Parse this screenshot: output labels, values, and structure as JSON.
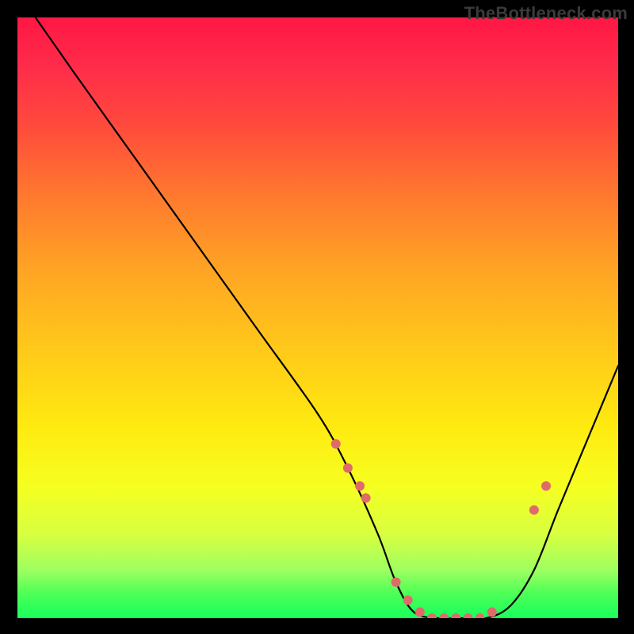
{
  "watermark": "TheBottleneck.com",
  "chart_data": {
    "type": "line",
    "title": "",
    "xlabel": "",
    "ylabel": "",
    "xlim": [
      0,
      100
    ],
    "ylim": [
      0,
      100
    ],
    "grid": false,
    "legend": false,
    "series": [
      {
        "name": "curve",
        "x": [
          3,
          10,
          20,
          30,
          40,
          50,
          55,
          60,
          63,
          66,
          70,
          74,
          78,
          82,
          86,
          90,
          95,
          100
        ],
        "y": [
          100,
          90,
          76,
          62,
          48,
          34,
          25,
          14,
          6,
          1,
          0,
          0,
          0,
          2,
          8,
          18,
          30,
          42
        ],
        "color": "#000000",
        "note": "V-shaped bottleneck curve; minimum (flat valley ≈0) at x≈66–78"
      },
      {
        "name": "markers",
        "type": "scatter",
        "x": [
          53,
          55,
          57,
          58,
          63,
          65,
          67,
          69,
          71,
          73,
          75,
          77,
          79,
          86,
          88
        ],
        "y": [
          29,
          25,
          22,
          20,
          6,
          3,
          1,
          0,
          0,
          0,
          0,
          0,
          1,
          18,
          22
        ],
        "color": "#e06a6a",
        "marker_size": 6
      }
    ],
    "background_gradient": {
      "direction": "top-to-bottom",
      "stops": [
        {
          "pos": 0,
          "color": "#ff1744"
        },
        {
          "pos": 30,
          "color": "#ff7a2e"
        },
        {
          "pos": 55,
          "color": "#ffc81a"
        },
        {
          "pos": 78,
          "color": "#f6ff20"
        },
        {
          "pos": 92,
          "color": "#9eff60"
        },
        {
          "pos": 100,
          "color": "#1aff5c"
        }
      ]
    }
  }
}
